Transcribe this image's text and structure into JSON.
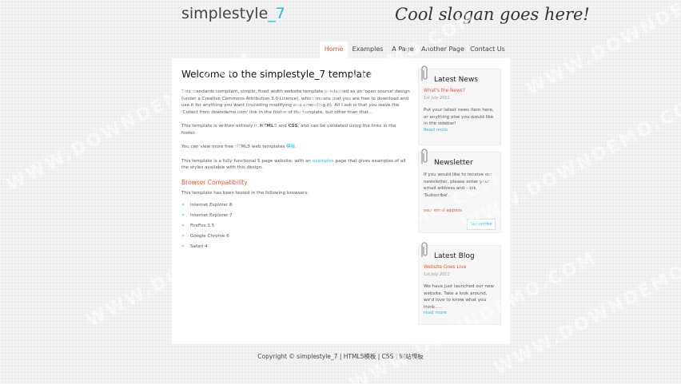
{
  "header": {
    "logo_main": "simplestyle",
    "logo_accent": "_7",
    "slogan": "Cool slogan goes here!"
  },
  "menu": {
    "items": [
      {
        "label": "Home",
        "active": true
      },
      {
        "label": "Examples",
        "active": false
      },
      {
        "label": "A Page",
        "active": false
      },
      {
        "label": "Another Page",
        "active": false
      },
      {
        "label": "Contact Us",
        "active": false
      }
    ]
  },
  "content": {
    "title": "Welcome to the simplestyle_7 template",
    "intro": "This standards compliant, simple, fixed width website template is released as an 'open source' design (under a Creative Commons Attribution 3.0 Licence), which means that you are free to download and use it for anything you want (including modifying and amending it). All I ask is that you leave the 'Collect from downdemo.com' link in the footer of the template, but other than that...",
    "html5_text_1": "This template is written entirely in ",
    "html5_strong": "HTML5",
    "html5_text_2": " and ",
    "css_strong": "CSS",
    "html5_text_3": ", and can be validated using the links in the footer.",
    "more_text": "You can view more free HTML5 web templates ",
    "more_link": "模板",
    "more_end": ".",
    "functional_text_1": "This template is a fully functional 5 page website, with an ",
    "functional_link": "examples",
    "functional_text_2": " page that gives examples of all the styles available with this design.",
    "subtitle": "Browser Compatibility",
    "tested_text": "This template has been tested in the following browsers:",
    "browsers": [
      "Internet Explorer 8",
      "Internet Explorer 7",
      "FireFox 3.5",
      "Google Chrome 6",
      "Safari 4"
    ]
  },
  "sidebar": {
    "news": {
      "title": "Latest News",
      "headline": "What's the News?",
      "date": "1st July 2011",
      "text": "Put your latest news item here, or anything else you would like in the sidebar!",
      "more": "Read more"
    },
    "newsletter": {
      "title": "Newsletter",
      "text": "If you would like to receive our newsletter, please enter your email address and click 'Subscribe'.",
      "email_value": "your email address",
      "subscribe_label": "Subscribe"
    },
    "blog": {
      "title": "Latest Blog",
      "headline": "Website Goes Live",
      "date": "1st July 2011",
      "text": "We have just launched our new website. Take a look around, we'd love to know what you think.....",
      "more": "read more"
    }
  },
  "footer": {
    "text": "Copyright © simplestyle_7 | HTML5模板 | CSS | 网站模板"
  },
  "watermark": "WWW.DOWNDEMO.COM",
  "colors": {
    "accent": "#1ec0e2",
    "highlight": "#e0582c",
    "background": "#eeeeee"
  }
}
